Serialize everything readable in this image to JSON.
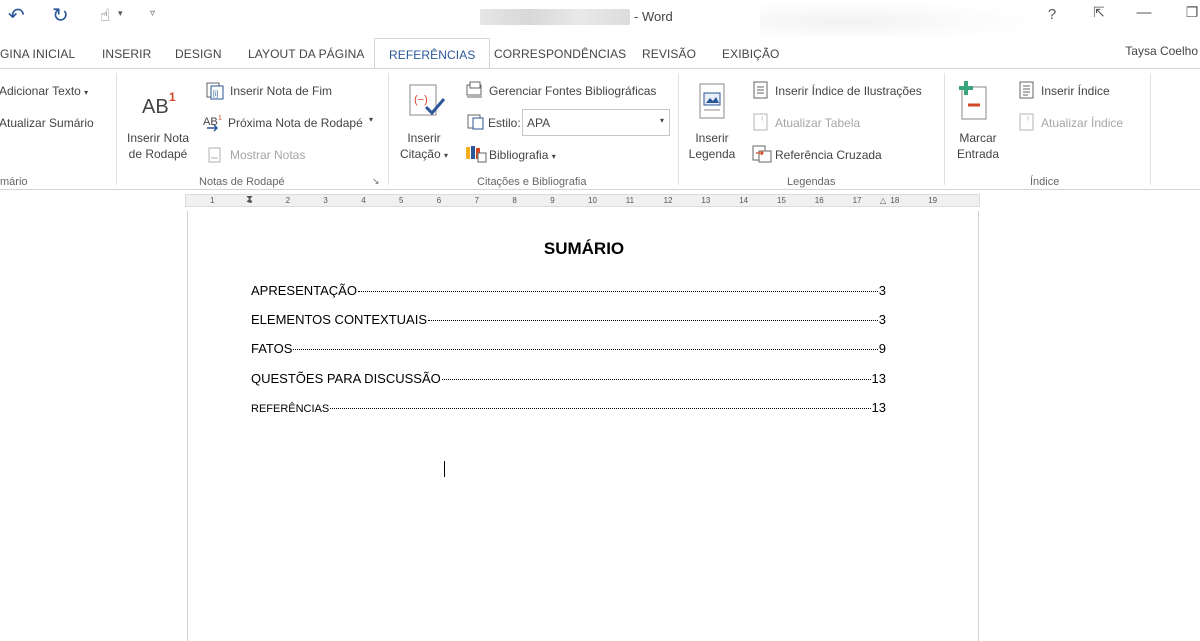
{
  "window": {
    "title_suffix": "- Word",
    "help": "?",
    "ribbon_display": "⇱",
    "minimize": "—",
    "restore": "❐"
  },
  "qat": {
    "undo": "↶",
    "redo": "↻",
    "touch": "☝",
    "touch_arrow": "▾",
    "customize": "▿"
  },
  "tabs": [
    {
      "label": "GINA INICIAL"
    },
    {
      "label": "INSERIR"
    },
    {
      "label": "DESIGN"
    },
    {
      "label": "LAYOUT DA PÁGINA"
    },
    {
      "label": "REFERÊNCIAS"
    },
    {
      "label": "CORRESPONDÊNCIAS"
    },
    {
      "label": "REVISÃO"
    },
    {
      "label": "EXIBIÇÃO"
    }
  ],
  "user": "Taysa Coelho",
  "ribbon": {
    "sumario": {
      "add_text": "Adicionar Texto",
      "update": "Atualizar Sumário",
      "label": "mário"
    },
    "notas": {
      "insert_footnote_line1": "Inserir Nota",
      "insert_footnote_line2": "de Rodapé",
      "insert_endnote": "Inserir Nota de Fim",
      "next_footnote": "Próxima Nota de Rodapé",
      "show_notes": "Mostrar Notas",
      "label": "Notas de Rodapé"
    },
    "citacoes": {
      "insert_citation_line1": "Inserir",
      "insert_citation_line2": "Citação",
      "manage_sources": "Gerenciar Fontes Bibliográficas",
      "style_label": "Estilo:",
      "style_value": "APA",
      "bibliography": "Bibliografia",
      "label": "Citações e Bibliografia"
    },
    "legendas": {
      "insert_caption_line1": "Inserir",
      "insert_caption_line2": "Legenda",
      "insert_table_figures": "Inserir Índice de Ilustrações",
      "update_table": "Atualizar Tabela",
      "cross_ref": "Referência Cruzada",
      "label": "Legendas"
    },
    "indice": {
      "mark_entry_line1": "Marcar",
      "mark_entry_line2": "Entrada",
      "insert_index": "Inserir Índice",
      "update_index": "Atualizar Índice",
      "label": "Índice"
    }
  },
  "ruler": [
    "1",
    "1",
    "2",
    "3",
    "4",
    "5",
    "6",
    "7",
    "8",
    "9",
    "10",
    "11",
    "12",
    "13",
    "14",
    "15",
    "16",
    "17",
    "18",
    "19"
  ],
  "document": {
    "title": "SUMÁRIO",
    "toc": [
      {
        "label": "APRESENTAÇÃO",
        "page": "3"
      },
      {
        "label": "ELEMENTOS CONTEXTUAIS",
        "page": "3"
      },
      {
        "label": "FATOS",
        "page": "9"
      },
      {
        "label": "QUESTÕES PARA DISCUSSÃO",
        "page": "13"
      },
      {
        "label": "REFERÊNCIAS",
        "page": "13"
      }
    ]
  }
}
